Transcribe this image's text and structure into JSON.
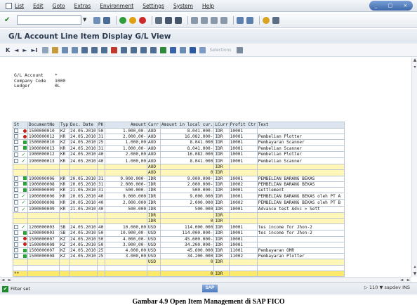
{
  "menu": [
    "List",
    "Edit",
    "Goto",
    "Extras",
    "Environment",
    "Settings",
    "System",
    "Help"
  ],
  "window_controls": [
    "_",
    "□",
    "×"
  ],
  "title": "G/L Account Line Item Display G/L View",
  "nav_buttons": [
    "K",
    "◄",
    "►",
    "►I"
  ],
  "selections_label": "Selections",
  "header_info": [
    {
      "key": "G/L Account",
      "value": "*"
    },
    {
      "key": "Company Code",
      "value": "1000"
    },
    {
      "key": "Ledger",
      "value": "0L"
    }
  ],
  "table": {
    "columns": [
      "St",
      "DocumentNo",
      "Typ",
      "Doc. Date",
      "PK",
      "Amount",
      "Curr",
      "Amount in local cur.",
      "LCurr",
      "Profit Ctr",
      "Text"
    ],
    "rows": [
      {
        "kind": "item",
        "st": "red",
        "doc": "1500000010",
        "typ": "KZ",
        "date": "24.05.2010",
        "pk": "50",
        "amount": "1.000,00-",
        "curr": "AUD",
        "local": "8.041.000-",
        "lcurr": "IDR",
        "pc": "10001",
        "text": ""
      },
      {
        "kind": "item",
        "st": "red",
        "doc": "1900000012",
        "typ": "KR",
        "date": "24.05.2010",
        "pk": "31",
        "amount": "2.000,00-",
        "curr": "AUD",
        "local": "16.082.000-",
        "lcurr": "IDR",
        "pc": "10001",
        "text": "Pembelian Plotter"
      },
      {
        "kind": "item",
        "st": "green",
        "doc": "1500000010",
        "typ": "KZ",
        "date": "24.05.2010",
        "pk": "25",
        "amount": "1.000,00",
        "curr": "AUD",
        "local": "8.041.000",
        "lcurr": "IDR",
        "pc": "10001",
        "text": "Pembayaran Scanner"
      },
      {
        "kind": "item",
        "st": "green",
        "doc": "1900000013",
        "typ": "KR",
        "date": "24.05.2010",
        "pk": "31",
        "amount": "1.000,00-",
        "curr": "AUD",
        "local": "8.041.000-",
        "lcurr": "IDR",
        "pc": "10001",
        "text": "Pembelian Scanner"
      },
      {
        "kind": "item",
        "st": "check",
        "doc": "1900000012",
        "typ": "KR",
        "date": "24.05.2010",
        "pk": "40",
        "amount": "2.000,00",
        "curr": "AUD",
        "local": "16.082.000",
        "lcurr": "IDR",
        "pc": "10001",
        "text": "Pembelian Plotter"
      },
      {
        "kind": "item",
        "st": "check",
        "doc": "1900000013",
        "typ": "KR",
        "date": "24.05.2010",
        "pk": "40",
        "amount": "1.000,00",
        "curr": "AUD",
        "local": "8.041.000",
        "lcurr": "IDR",
        "pc": "10001",
        "text": "Pembelian Scanner"
      },
      {
        "kind": "sub",
        "st": "",
        "doc": "",
        "typ": "",
        "date": "",
        "pk": "",
        "amount": "",
        "curr": "AUD",
        "local": "",
        "lcurr": "IDR",
        "pc": "",
        "text": ""
      },
      {
        "kind": "sub",
        "st": "",
        "doc": "",
        "typ": "",
        "date": "",
        "pk": "",
        "amount": "",
        "curr": "AUD",
        "local": "0",
        "lcurr": "IDR",
        "pc": "",
        "text": ""
      },
      {
        "kind": "item",
        "st": "green",
        "doc": "1900000006",
        "typ": "KR",
        "date": "20.05.2010",
        "pk": "31",
        "amount": "9.000.000-",
        "curr": "IDR",
        "local": "9.000.000-",
        "lcurr": "IDR",
        "pc": "10001",
        "text": "PEMBELIAN BARANG BEKAS"
      },
      {
        "kind": "item",
        "st": "green",
        "doc": "1900000008",
        "typ": "KR",
        "date": "20.05.2010",
        "pk": "31",
        "amount": "2.000.000-",
        "curr": "IDR",
        "local": "2.000.000-",
        "lcurr": "IDR",
        "pc": "10002",
        "text": "PEMBELIAN BARANG BEKAS"
      },
      {
        "kind": "item",
        "st": "green",
        "doc": "1900000009",
        "typ": "KR",
        "date": "21.05.2010",
        "pk": "31",
        "amount": "500.000-",
        "curr": "IDR",
        "local": "500.000-",
        "lcurr": "IDR",
        "pc": "10001",
        "text": "settlement"
      },
      {
        "kind": "item",
        "st": "check",
        "doc": "1900000006",
        "typ": "KR",
        "date": "20.05.2010",
        "pk": "40",
        "amount": "9.000.000",
        "curr": "IDR",
        "local": "9.000.000",
        "lcurr": "IDR",
        "pc": "10001",
        "text": "PEMBELIAN BARANG BEKAS oleh PT A"
      },
      {
        "kind": "item",
        "st": "check",
        "doc": "1900000008",
        "typ": "KR",
        "date": "20.05.2010",
        "pk": "40",
        "amount": "2.000.000",
        "curr": "IDR",
        "local": "2.000.000",
        "lcurr": "IDR",
        "pc": "10002",
        "text": "PEMBELIAN BARANG BEKAS oleh PT B"
      },
      {
        "kind": "item",
        "st": "check",
        "doc": "1900000009",
        "typ": "KR",
        "date": "21.05.2010",
        "pk": "40",
        "amount": "500.000",
        "curr": "IDR",
        "local": "500.000",
        "lcurr": "IDR",
        "pc": "10001",
        "text": "Advance test Advc > Sett"
      },
      {
        "kind": "sub",
        "st": "",
        "doc": "",
        "typ": "",
        "date": "",
        "pk": "",
        "amount": "",
        "curr": "IDR",
        "local": "",
        "lcurr": "IDR",
        "pc": "",
        "text": ""
      },
      {
        "kind": "sub",
        "st": "",
        "doc": "",
        "typ": "",
        "date": "",
        "pk": "",
        "amount": "",
        "curr": "IDR",
        "local": "0",
        "lcurr": "IDR",
        "pc": "",
        "text": ""
      },
      {
        "kind": "item",
        "st": "check",
        "doc": "1200000003",
        "typ": "SB",
        "date": "24.05.2010",
        "pk": "40",
        "amount": "10.000,00",
        "curr": "USD",
        "local": "114.000.000",
        "lcurr": "IDR",
        "pc": "10001",
        "text": "tes income for Jhon-2"
      },
      {
        "kind": "item",
        "st": "green",
        "doc": "1200000003",
        "typ": "SB",
        "date": "24.05.2010",
        "pk": "50",
        "amount": "10.000,00-",
        "curr": "USD",
        "local": "114.000.000-",
        "lcurr": "IDR",
        "pc": "10001",
        "text": "tes income for Jhon-2"
      },
      {
        "kind": "item",
        "st": "red",
        "doc": "1500000007",
        "typ": "KZ",
        "date": "24.05.2010",
        "pk": "50",
        "amount": "4.000,00-",
        "curr": "USD",
        "local": "45.600.000-",
        "lcurr": "IDR",
        "pc": "10001",
        "text": ""
      },
      {
        "kind": "item",
        "st": "red",
        "doc": "1500000008",
        "typ": "KZ",
        "date": "24.05.2010",
        "pk": "50",
        "amount": "3.000,00-",
        "curr": "USD",
        "local": "34.200.000-",
        "lcurr": "IDR",
        "pc": "10001",
        "text": ""
      },
      {
        "kind": "item",
        "st": "green",
        "doc": "1500000007",
        "typ": "KZ",
        "date": "24.05.2010",
        "pk": "25",
        "amount": "4.000,00",
        "curr": "USD",
        "local": "45.600.000",
        "lcurr": "IDR",
        "pc": "11001",
        "text": "Pembayaran OMR"
      },
      {
        "kind": "item",
        "st": "green",
        "doc": "1500000008",
        "typ": "KZ",
        "date": "24.05.2010",
        "pk": "25",
        "amount": "3.000,00",
        "curr": "USD",
        "local": "34.200.000",
        "lcurr": "IDR",
        "pc": "11002",
        "text": "Pembayaran Plotter"
      },
      {
        "kind": "sub",
        "st": "",
        "doc": "",
        "typ": "",
        "date": "",
        "pk": "",
        "amount": "",
        "curr": "USD",
        "local": "0",
        "lcurr": "IDR",
        "pc": "",
        "text": ""
      },
      {
        "kind": "blank",
        "st": "",
        "doc": "",
        "typ": "",
        "date": "",
        "pk": "",
        "amount": "",
        "curr": "",
        "local": "",
        "lcurr": "",
        "pc": "",
        "text": ""
      },
      {
        "kind": "total",
        "st": "**",
        "doc": "",
        "typ": "",
        "date": "",
        "pk": "",
        "amount": "",
        "curr": "",
        "local": "0",
        "lcurr": "IDR",
        "pc": "",
        "text": ""
      }
    ]
  },
  "status": {
    "message": "Filter set",
    "sap_logo": "SAP",
    "system": "110",
    "host": "sapdev",
    "mode": "INS"
  },
  "caption": "Gambar 4.9 Open Item Management di SAP FICO"
}
